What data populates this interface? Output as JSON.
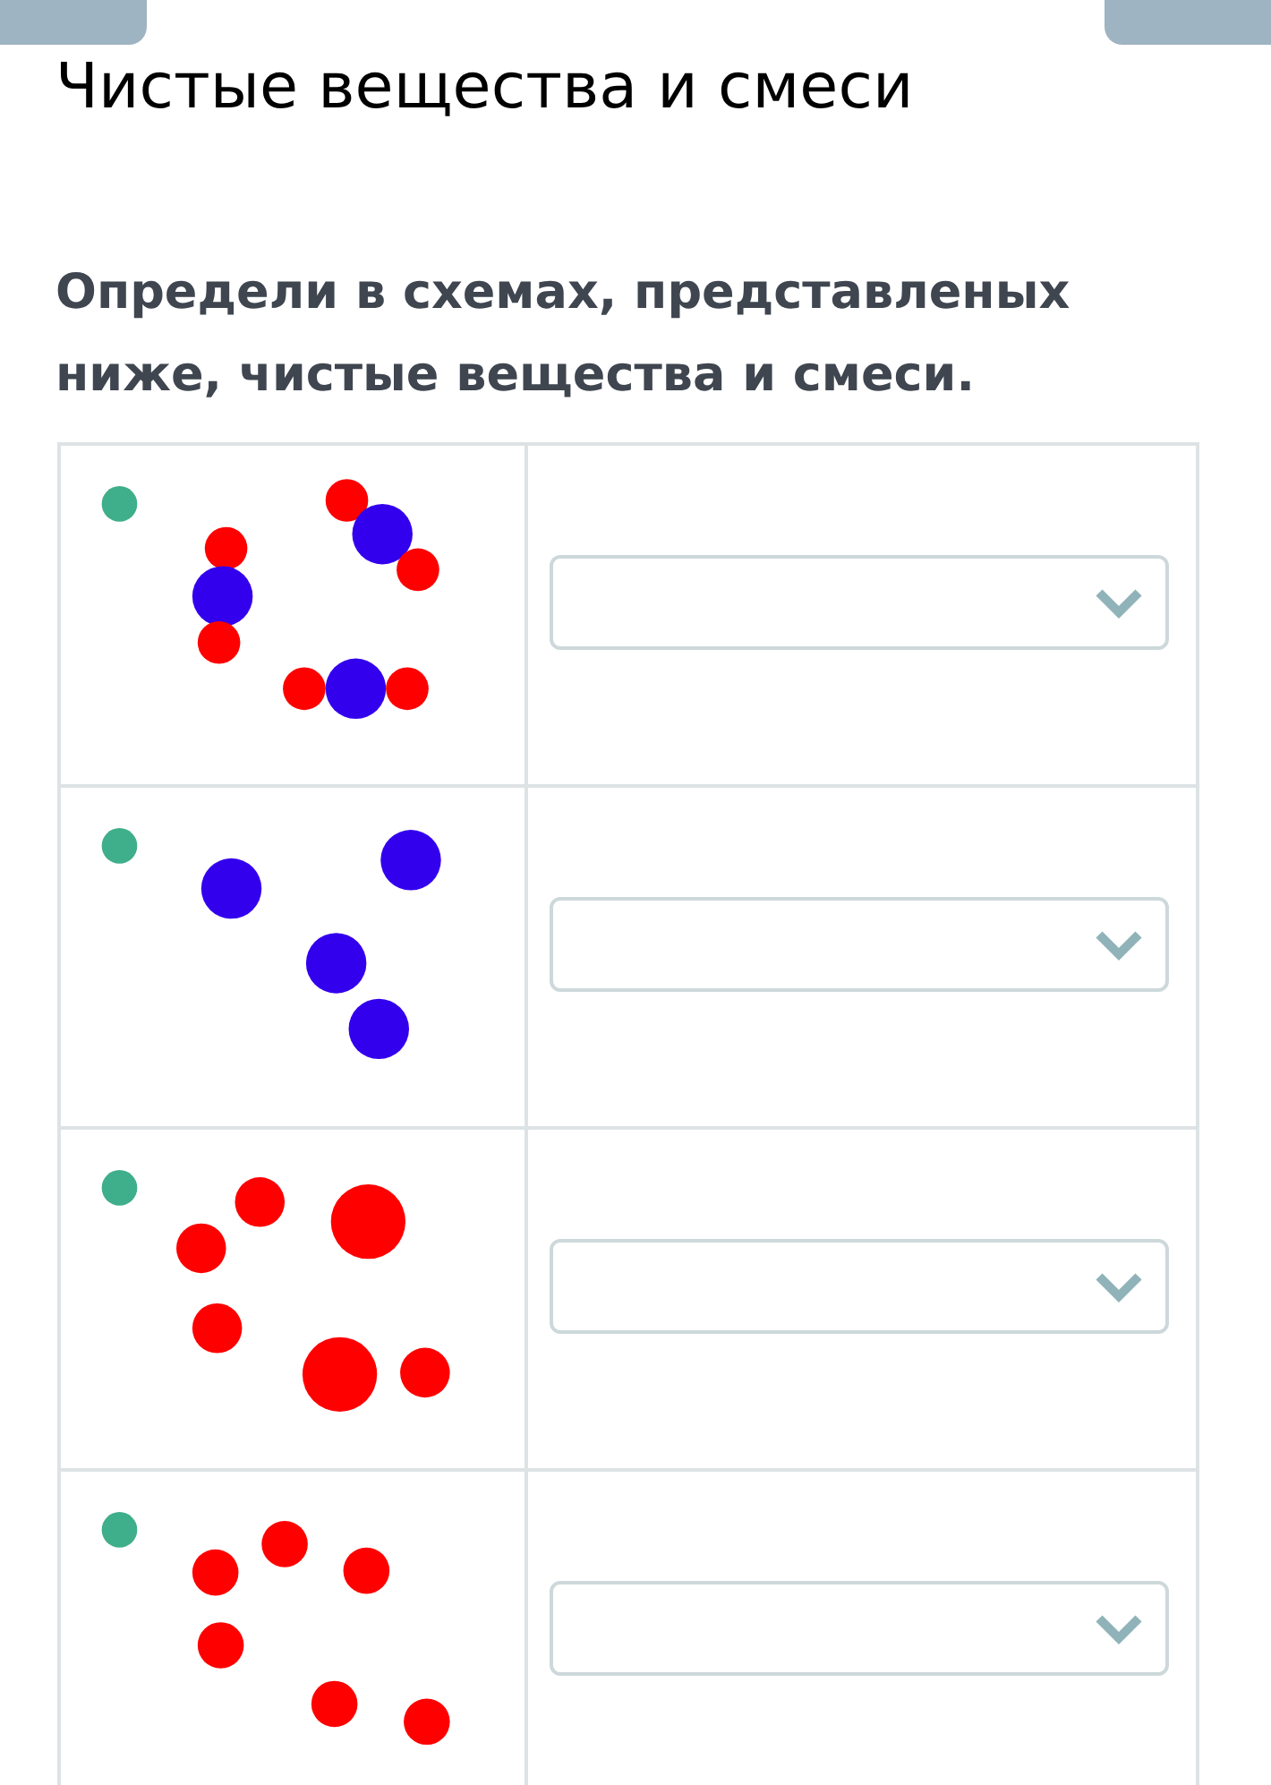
{
  "title": "Чистые вещества и смеси",
  "question": "Определи в схемах, представленых ниже, чистые вещества и смеси.",
  "rows": [
    {
      "kind": "picture",
      "dropdown": {
        "expanded": false
      }
    },
    {
      "kind": "picture",
      "dropdown": {
        "expanded": false
      }
    },
    {
      "kind": "picture",
      "dropdown": {
        "expanded": false
      }
    },
    {
      "kind": "picture",
      "dropdown": {
        "expanded": false
      }
    }
  ]
}
